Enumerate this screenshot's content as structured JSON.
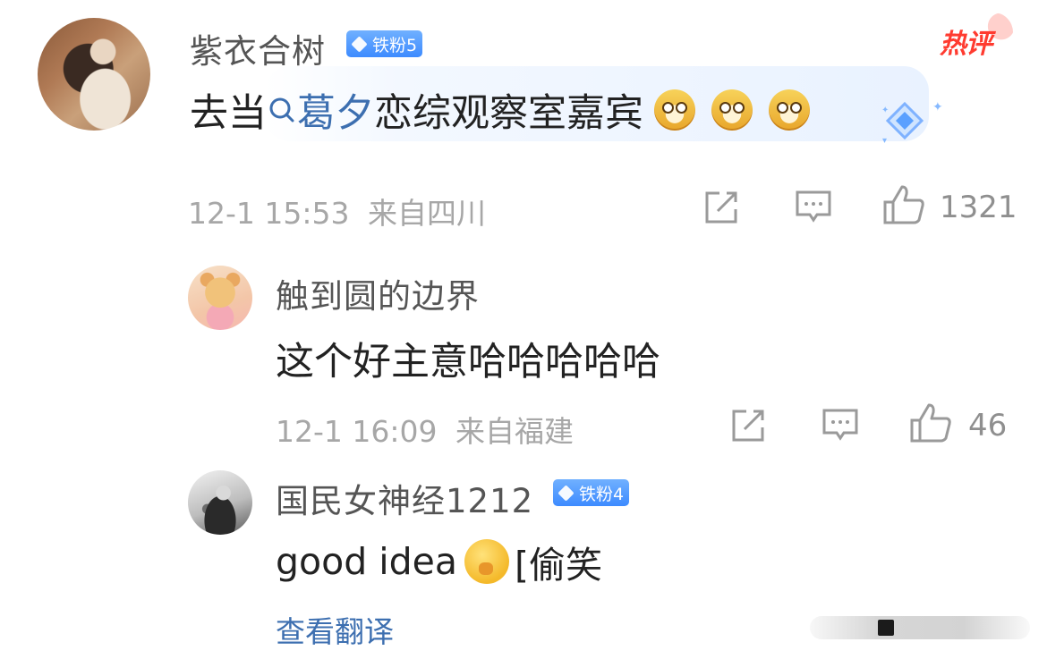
{
  "comments": [
    {
      "username": "紫衣合树",
      "badge": "铁粉5",
      "hot_label": "热评",
      "content_prefix": "去当",
      "content_link": "葛夕",
      "content_suffix": "恋综观察室嘉宾",
      "emojis": [
        "doge",
        "doge",
        "doge"
      ],
      "timestamp": "12-1 15:53",
      "location": "来自四川",
      "likes": "1321"
    }
  ],
  "replies": [
    {
      "username": "触到圆的边界",
      "content": "这个好主意哈哈哈哈哈",
      "timestamp": "12-1 16:09",
      "location": "来自福建",
      "likes": "46"
    },
    {
      "username": "国民女神经1212",
      "badge": "铁粉4",
      "content_text": "good idea",
      "content_tail": "[偷笑",
      "emoji": "thinking-face"
    }
  ],
  "translate_label": "查看翻译",
  "icons": {
    "share": "share-icon",
    "comment": "comment-icon",
    "like": "like-icon",
    "search": "search-icon"
  },
  "colors": {
    "link": "#3d6fb0",
    "badge": "#3d8bff",
    "hot": "#ff3b30",
    "meta": "#a7a7a7"
  }
}
